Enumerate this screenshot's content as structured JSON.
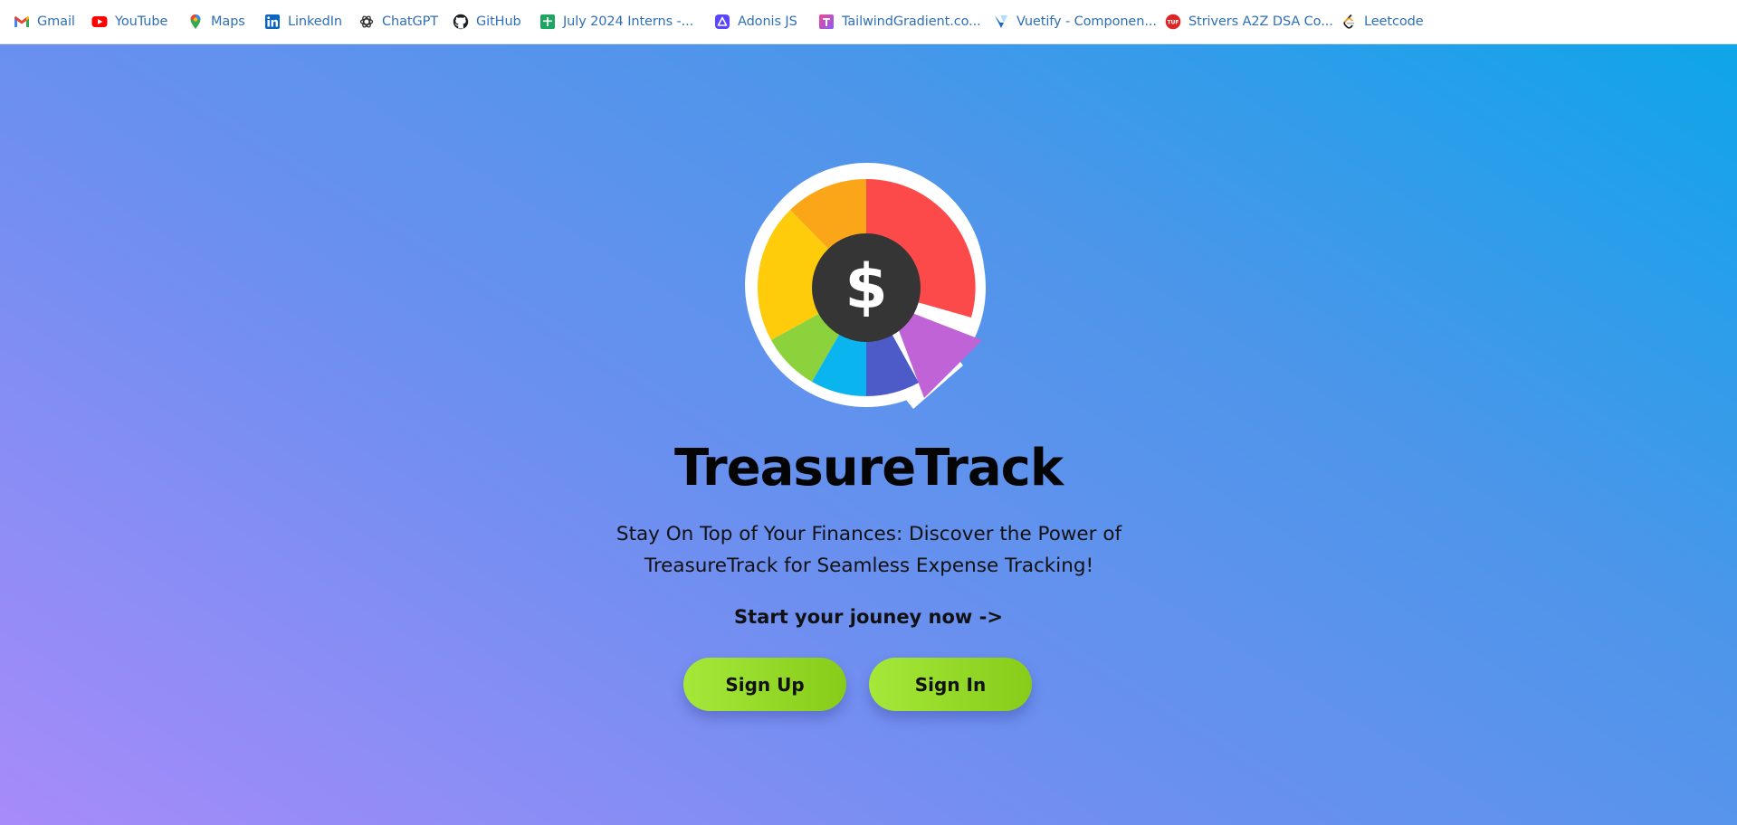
{
  "bookmarks": [
    {
      "label": "Gmail",
      "icon": "gmail-icon"
    },
    {
      "label": "YouTube",
      "icon": "youtube-icon"
    },
    {
      "label": "Maps",
      "icon": "maps-icon"
    },
    {
      "label": "LinkedIn",
      "icon": "linkedin-icon"
    },
    {
      "label": "ChatGPT",
      "icon": "chatgpt-icon"
    },
    {
      "label": "GitHub",
      "icon": "github-icon"
    },
    {
      "label": "July 2024 Interns -...",
      "icon": "sheets-icon"
    },
    {
      "label": "Adonis JS",
      "icon": "adonisjs-icon"
    },
    {
      "label": "TailwindGradient.co...",
      "icon": "tailwindgradient-icon"
    },
    {
      "label": "Vuetify - Componen...",
      "icon": "vuetify-icon"
    },
    {
      "label": "Strivers A2Z DSA Co...",
      "icon": "tuf-icon"
    },
    {
      "label": "Leetcode",
      "icon": "leetcode-icon"
    }
  ],
  "hero": {
    "title": "TreasureTrack",
    "tagline": "Stay On Top of Your Finances: Discover the Power of TreasureTrack for Seamless Expense Tracking!",
    "cta": "Start your jouney now ->",
    "signup_label": "Sign Up",
    "signin_label": "Sign In",
    "logo_glyph": "$"
  },
  "colors": {
    "bookmark_text": "#2f6fb5",
    "button": "#95d82a",
    "gradient_top_right": "#0ea5e9",
    "gradient_bottom_left": "#a78bfa"
  }
}
